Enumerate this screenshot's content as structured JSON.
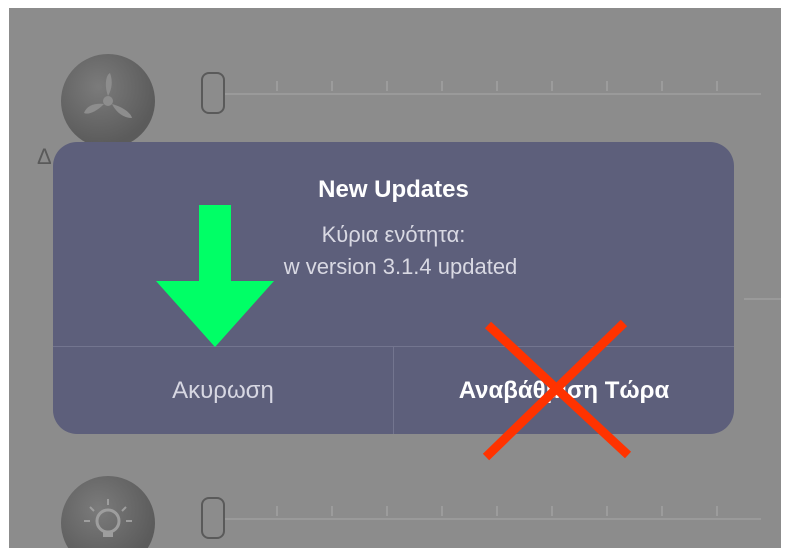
{
  "background": {
    "fan_label": "Δ ..."
  },
  "dialog": {
    "title": "New Updates",
    "message_line1": "Κύρια ενότητα:",
    "message_line2": "w version 3.1.4 updated",
    "cancel_label": "Ακυρωση",
    "update_label": "Αναβάθμιση Τώρα"
  },
  "overlays": {
    "arrow_color": "#00ff66",
    "x_color": "#ff3300"
  },
  "colors": {
    "dialog_bg": "#5d5f7b",
    "screen_dim": "#8c8c8c"
  }
}
